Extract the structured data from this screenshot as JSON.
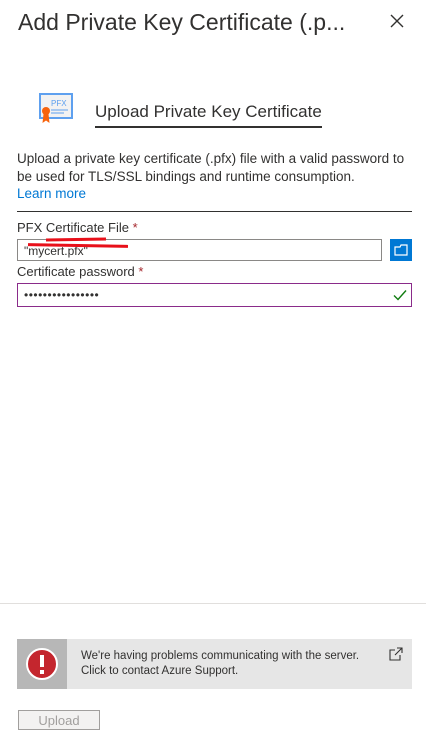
{
  "header": {
    "title": "Add Private Key Certificate (.p...",
    "close_icon": "close-icon"
  },
  "upload_section": {
    "icon_label": "PFX",
    "title": "Upload Private Key Certificate"
  },
  "description": {
    "text": "Upload a private key certificate (.pfx) file with a valid password to be used for TLS/SSL bindings and runtime consumption.",
    "learn_more": "Learn more"
  },
  "form": {
    "pfx_file": {
      "label": "PFX Certificate File",
      "required_mark": "*",
      "value": "\"mycert.pfx\""
    },
    "password": {
      "label": "Certificate password",
      "required_mark": "*",
      "value": "••••••••••••••••"
    }
  },
  "error": {
    "line1": "We're having problems communicating with the server.",
    "line2": "Click to contact Azure Support."
  },
  "footer": {
    "upload_label": "Upload"
  },
  "colors": {
    "accent": "#0078d4",
    "required": "#a4262c",
    "error_red": "#c4262e",
    "valid_check": "#107c10",
    "focus_border": "#8a2b8a"
  }
}
